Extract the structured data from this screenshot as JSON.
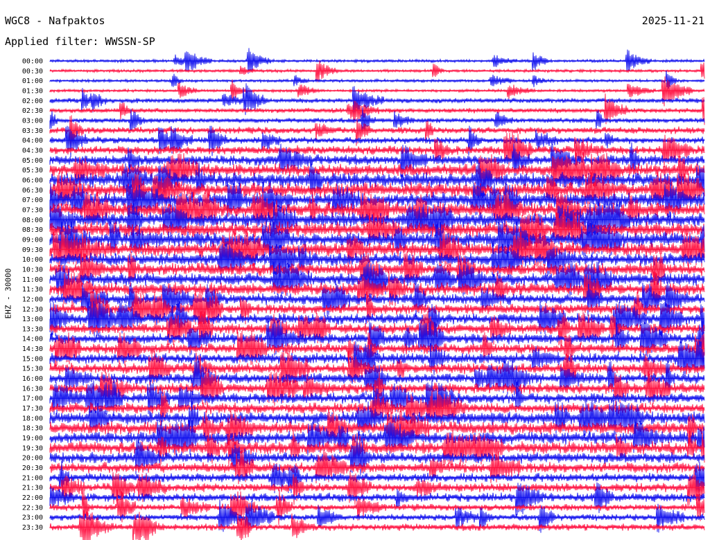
{
  "header": {
    "station": "WGC8 - Nafpaktos",
    "date": "2025-11-21",
    "filter": "Applied filter: WWSSN-SP",
    "channel": "EHZ - 30000"
  },
  "chart_data": {
    "type": "helicorder",
    "title": "WGC8 - Nafpaktos",
    "date": "2025-11-21",
    "filter": "WWSSN-SP",
    "ylabel": "EHZ - 30000",
    "line_interval_minutes": 30,
    "row_labels": [
      "00:00",
      "00:30",
      "01:00",
      "01:30",
      "02:00",
      "02:30",
      "03:00",
      "03:30",
      "04:00",
      "04:30",
      "05:00",
      "05:30",
      "06:00",
      "06:30",
      "07:00",
      "07:30",
      "08:00",
      "08:30",
      "09:00",
      "09:30",
      "10:00",
      "10:30",
      "11:00",
      "11:30",
      "12:00",
      "12:30",
      "13:00",
      "13:30",
      "14:00",
      "14:30",
      "15:00",
      "15:30",
      "16:00",
      "16:30",
      "17:00",
      "17:30",
      "18:00",
      "18:30",
      "19:00",
      "19:30",
      "20:00",
      "20:30",
      "21:00",
      "21:30",
      "22:00",
      "22:30",
      "23:00",
      "23:30"
    ],
    "series_colors": [
      "#1010ee",
      "#ff1040"
    ],
    "relative_noise_level": [
      1,
      1,
      1,
      1,
      2,
      2,
      2,
      3,
      3,
      4,
      5,
      6,
      7,
      7,
      7,
      7,
      7,
      7,
      7,
      7,
      6,
      6,
      6,
      6,
      5,
      5,
      5,
      5,
      5,
      5,
      5,
      5,
      5,
      5,
      5,
      5,
      6,
      6,
      6,
      6,
      5,
      5,
      4,
      4,
      4,
      3,
      3,
      3
    ]
  }
}
